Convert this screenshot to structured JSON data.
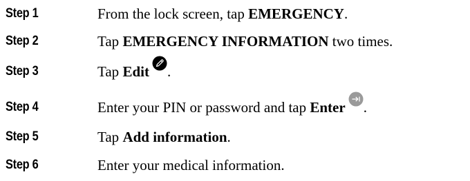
{
  "steps": [
    {
      "label": "Step 1",
      "before": "From the lock screen, tap ",
      "bold": "EMERGENCY",
      "after": "."
    },
    {
      "label": "Step 2",
      "before": "Tap ",
      "bold": "EMERGENCY INFORMATION",
      "after": " two times."
    },
    {
      "label": "Step 3",
      "before": "Tap ",
      "bold": "Edit",
      "icon": "edit-pencil-icon",
      "after": "."
    },
    {
      "label": "Step 4",
      "before": "Enter your PIN or password and tap ",
      "bold": "Enter",
      "icon": "enter-arrow-icon",
      "after": "."
    },
    {
      "label": "Step 5",
      "before": "Tap ",
      "bold": "Add information",
      "after": "."
    },
    {
      "label": "Step 6",
      "before": "Enter your medical information.",
      "bold": "",
      "after": ""
    }
  ],
  "colors": {
    "text": "#000000",
    "edit_icon_fill": "#000000",
    "enter_icon_fill": "#9a9a9a"
  }
}
